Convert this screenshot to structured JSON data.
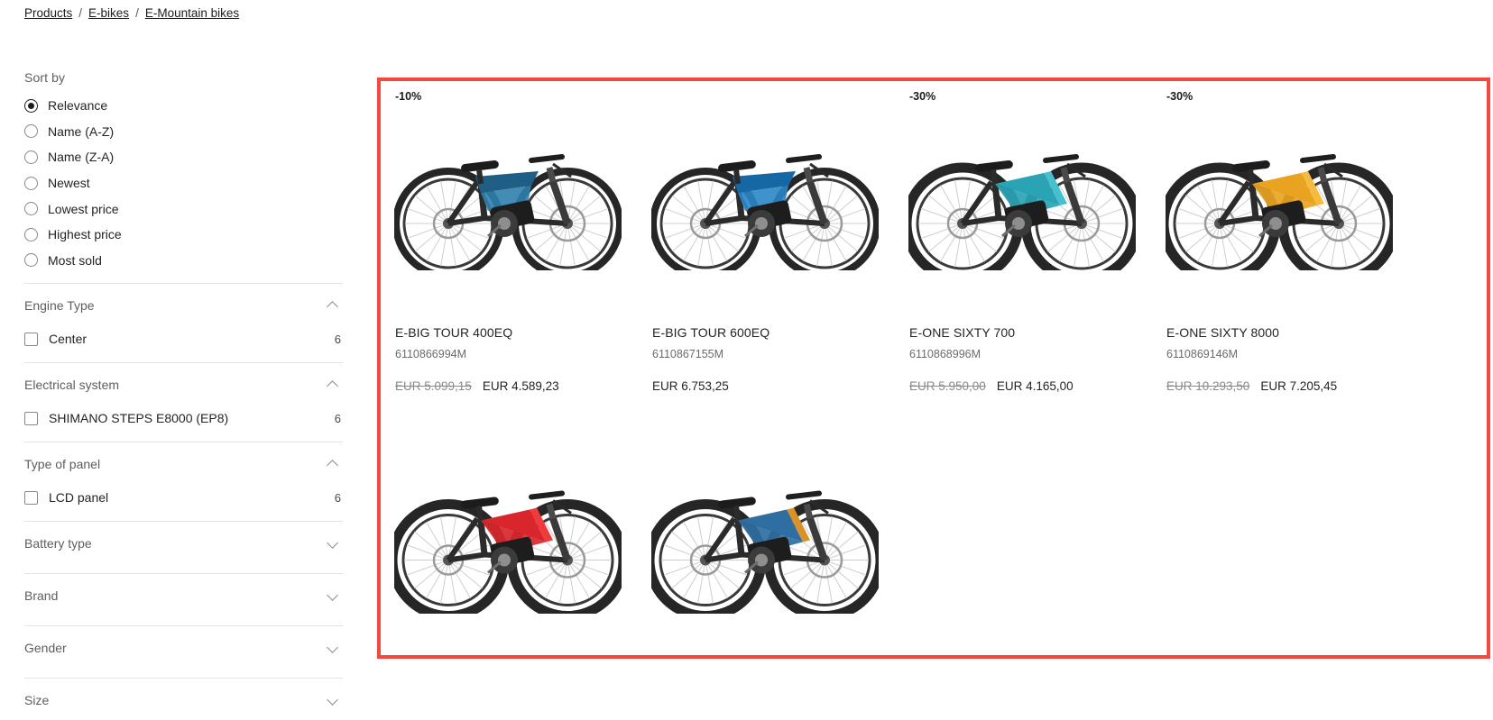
{
  "breadcrumb": {
    "items": [
      {
        "label": "Products"
      },
      {
        "label": "E-bikes"
      },
      {
        "label": "E-Mountain bikes"
      }
    ],
    "separator": "/"
  },
  "sidebar": {
    "sort": {
      "title": "Sort by",
      "selected": "Relevance",
      "options": [
        {
          "label": "Relevance",
          "selected": true
        },
        {
          "label": "Name (A-Z)",
          "selected": false
        },
        {
          "label": "Name (Z-A)",
          "selected": false
        },
        {
          "label": "Newest",
          "selected": false
        },
        {
          "label": "Lowest price",
          "selected": false
        },
        {
          "label": "Highest price",
          "selected": false
        },
        {
          "label": "Most sold",
          "selected": false
        }
      ]
    },
    "filters": [
      {
        "label": "Engine Type",
        "expanded": true,
        "chevron": "chevron-up-icon",
        "options": [
          {
            "label": "Center",
            "count": "6",
            "checked": false
          }
        ]
      },
      {
        "label": "Electrical system",
        "expanded": true,
        "chevron": "chevron-up-icon",
        "options": [
          {
            "label": "SHIMANO STEPS E8000 (EP8)",
            "count": "6",
            "checked": false
          }
        ]
      },
      {
        "label": "Type of panel",
        "expanded": true,
        "chevron": "chevron-up-icon",
        "options": [
          {
            "label": "LCD panel",
            "count": "6",
            "checked": false
          }
        ]
      },
      {
        "label": "Battery type",
        "expanded": false,
        "chevron": "chevron-down-icon",
        "options": []
      },
      {
        "label": "Brand",
        "expanded": false,
        "chevron": "chevron-down-icon",
        "options": []
      },
      {
        "label": "Gender",
        "expanded": false,
        "chevron": "chevron-down-icon",
        "options": []
      },
      {
        "label": "Size",
        "expanded": false,
        "chevron": "chevron-down-icon",
        "options": []
      }
    ]
  },
  "results": {
    "highlight_color": "#f4483f",
    "products": [
      {
        "badge": "-10%",
        "title": "E-BIG TOUR 400EQ",
        "sku": "6110866994M",
        "price_old": "EUR 5.099,15",
        "price_now": "EUR 4.589,23",
        "frame_color": "#1f5f86",
        "accent_color": "#2d7fae",
        "type": "trekking"
      },
      {
        "badge": "",
        "title": "E-BIG TOUR 600EQ",
        "sku": "6110867155M",
        "price_old": "",
        "price_now": "EUR 6.753,25",
        "frame_color": "#1668a5",
        "accent_color": "#2b86c7",
        "type": "trekking"
      },
      {
        "badge": "-30%",
        "title": "E-ONE SIXTY 700",
        "sku": "6110868996M",
        "price_old": "EUR 5.950,00",
        "price_now": "EUR 4.165,00",
        "frame_color": "#2aa3b5",
        "accent_color": "#46c0cf",
        "type": "mtb"
      },
      {
        "badge": "-30%",
        "title": "E-ONE SIXTY 8000",
        "sku": "6110869146M",
        "price_old": "EUR 10.293,50",
        "price_now": "EUR 7.205,45",
        "frame_color": "#e9a321",
        "accent_color": "#f5bb3d",
        "type": "mtb"
      },
      {
        "badge": "",
        "title": "",
        "sku": "",
        "price_old": "",
        "price_now": "",
        "frame_color": "#d8262c",
        "accent_color": "#ef3b3b",
        "type": "mtb"
      },
      {
        "badge": "",
        "title": "",
        "sku": "",
        "price_old": "",
        "price_now": "",
        "frame_color": "#2f6ea0",
        "accent_color": "#d9912a",
        "type": "mtb"
      }
    ]
  }
}
